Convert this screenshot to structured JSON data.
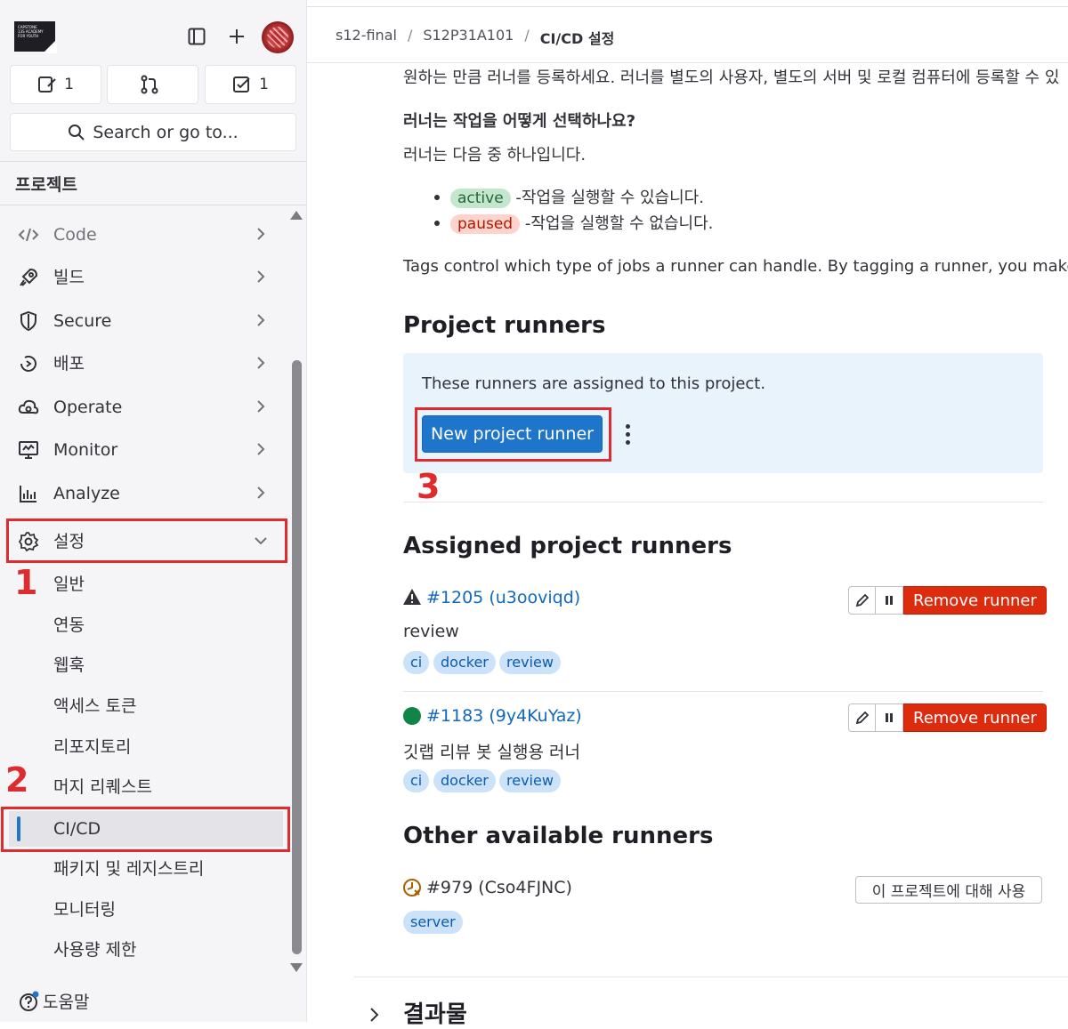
{
  "sidebar": {
    "logo_text": "CAPSTONE 13S ACADEMY FOR YOUTH",
    "counters": [
      {
        "icon": "issues-icon",
        "value": "1"
      },
      {
        "icon": "merge-request-icon",
        "value": ""
      },
      {
        "icon": "todo-icon",
        "value": "1"
      }
    ],
    "search_label": "Search or go to...",
    "section_title": "프로젝트",
    "nav": [
      {
        "label": "Code",
        "icon": "code-icon"
      },
      {
        "label": "빌드",
        "icon": "rocket-icon"
      },
      {
        "label": "Secure",
        "icon": "shield-icon"
      },
      {
        "label": "배포",
        "icon": "deploy-icon"
      },
      {
        "label": "Operate",
        "icon": "cloud-icon"
      },
      {
        "label": "Monitor",
        "icon": "monitor-icon"
      },
      {
        "label": "Analyze",
        "icon": "chart-icon"
      },
      {
        "label": "설정",
        "icon": "gear-icon"
      }
    ],
    "settings_sub": [
      "일반",
      "연동",
      "웹훅",
      "액세스 토큰",
      "리포지토리",
      "머지 리퀘스트",
      "CI/CD",
      "패키지 및 레지스트리",
      "모니터링",
      "사용량 제한"
    ],
    "help_label": "도움말",
    "annotations": [
      "1",
      "2",
      "3"
    ]
  },
  "breadcrumb": [
    "s12-final",
    "S12P31A101",
    "CI/CD 설정"
  ],
  "content": {
    "intro_line": "원하는 만큼 러너를 등록하세요. 러너를 별도의 사용자, 별도의 서버 및 로컬 컴퓨터에 등록할 수 있",
    "question": "러너는 작업을 어떻게 선택하나요?",
    "runner_is": "러너는 다음 중 하나입니다.",
    "states": [
      {
        "badge": "active",
        "text": "-작업을 실행할 수 있습니다."
      },
      {
        "badge": "paused",
        "text": "-작업을 실행할 수 없습니다."
      }
    ],
    "tags_text": "Tags control which type of jobs a runner can handle. By tagging a runner, you make s",
    "project_runners_title": "Project runners",
    "info_text": "These runners are assigned to this project.",
    "new_runner_button": "New project runner",
    "assigned_title": "Assigned project runners",
    "runners": [
      {
        "id": "#1205 (u3ooviqd)",
        "status_icon": "warning-icon",
        "description": "review",
        "tags": [
          "ci",
          "docker",
          "review"
        ],
        "remove_label": "Remove runner"
      },
      {
        "id": "#1183 (9y4KuYaz)",
        "status_icon": "online-dot-icon",
        "description": "깃랩 리뷰 봇 실행용 러너",
        "tags": [
          "ci",
          "docker",
          "review"
        ],
        "remove_label": "Remove runner"
      }
    ],
    "other_title": "Other available runners",
    "other_runner": {
      "id": "#979 (Cso4FJNC)",
      "status_icon": "stale-clock-icon",
      "tags": [
        "server"
      ],
      "enable_label": "이 프로젝트에 대해 사용"
    },
    "artifacts_title": "결과물"
  },
  "colors": {
    "accent": "#1f75cb",
    "danger": "#dd2b0e",
    "annotation": "#dd2b2e",
    "online": "#108548"
  }
}
